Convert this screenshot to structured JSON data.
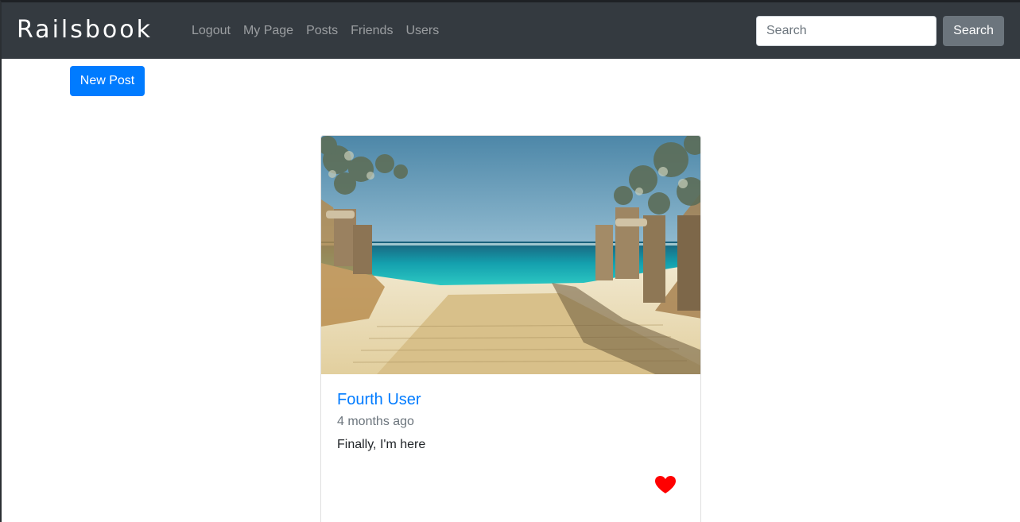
{
  "navbar": {
    "brand": "Railsbook",
    "links": [
      "Logout",
      "My Page",
      "Posts",
      "Friends",
      "Users"
    ],
    "search": {
      "placeholder": "Search",
      "value": ""
    },
    "search_button_label": "Search"
  },
  "main": {
    "new_post_label": "New Post",
    "post": {
      "author": "Fourth User",
      "time_ago": "4 months ago",
      "text": "Finally, I'm here",
      "image_icon": "beach-boardwalk-photo",
      "like_icon": "heart-icon"
    }
  },
  "colors": {
    "navbar_bg": "#343a40",
    "primary": "#007bff",
    "secondary": "#6c757d",
    "like": "#ff0000"
  }
}
